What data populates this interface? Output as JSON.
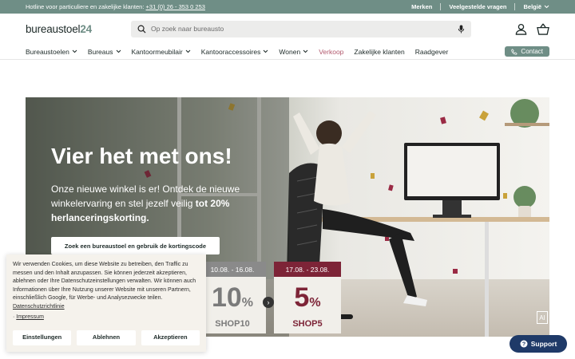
{
  "topbar": {
    "hotline_text": "Hotline voor particuliere en zakelijke klanten:",
    "hotline_number": "+31 (0) 26 - 353 0 253",
    "merken": "Merken",
    "faq": "Veelgestelde vragen",
    "country": "België"
  },
  "header": {
    "logo_text": "bureaustoel",
    "logo_num": "24",
    "search_placeholder": "Op zoek naar bureausto"
  },
  "nav": {
    "items": [
      {
        "label": "Bureaustoelen"
      },
      {
        "label": "Bureaus"
      },
      {
        "label": "Kantoormeubilair"
      },
      {
        "label": "Kantooraccessoires"
      },
      {
        "label": "Wonen"
      },
      {
        "label": "Verkoop"
      },
      {
        "label": "Zakelijke klanten"
      },
      {
        "label": "Raadgever"
      }
    ],
    "contact": "Contact"
  },
  "hero": {
    "title": "Vier het met ons!",
    "text_part1": "Onze nieuwe winkel is er! Ontdek de nieuwe winkelervaring en stel jezelf veilig ",
    "text_bold": "tot 20% herlanceringskorting.",
    "cta": "Zoek een bureaustoel en gebruik de kortingscode",
    "coupons": [
      {
        "dates": "10.08. - 16.08.",
        "percent": "10",
        "code": "SHOP10",
        "color": "#8a8a8a"
      },
      {
        "dates": "17.08. - 23.08.",
        "percent": "5",
        "code": "SHOP5",
        "color": "#7d2437"
      }
    ],
    "next_arrow": "›",
    "ai_badge": "AI"
  },
  "cookie": {
    "text": "Wir verwenden Cookies, um diese Website zu betreiben, den Traffic zu messen und den Inhalt anzupassen. Sie können jederzeit akzeptieren, ablehnen oder Ihre Datenschutzeinstellungen verwalten. Wir können auch Informationen über Ihre Nutzung unserer Website mit unseren Partnern, einschließlich Google, für Werbe- und Analysezwecke teilen.",
    "privacy_link": "Datenschutzrichtlinie",
    "imprint_link": "Impressum",
    "settings": "Einstellungen",
    "decline": "Ablehnen",
    "accept": "Akzeptieren"
  },
  "support": {
    "label": "Support"
  },
  "colors": {
    "topbar": "#6f8e86",
    "accent_sale": "#b25a6e",
    "support": "#1f3a68"
  }
}
